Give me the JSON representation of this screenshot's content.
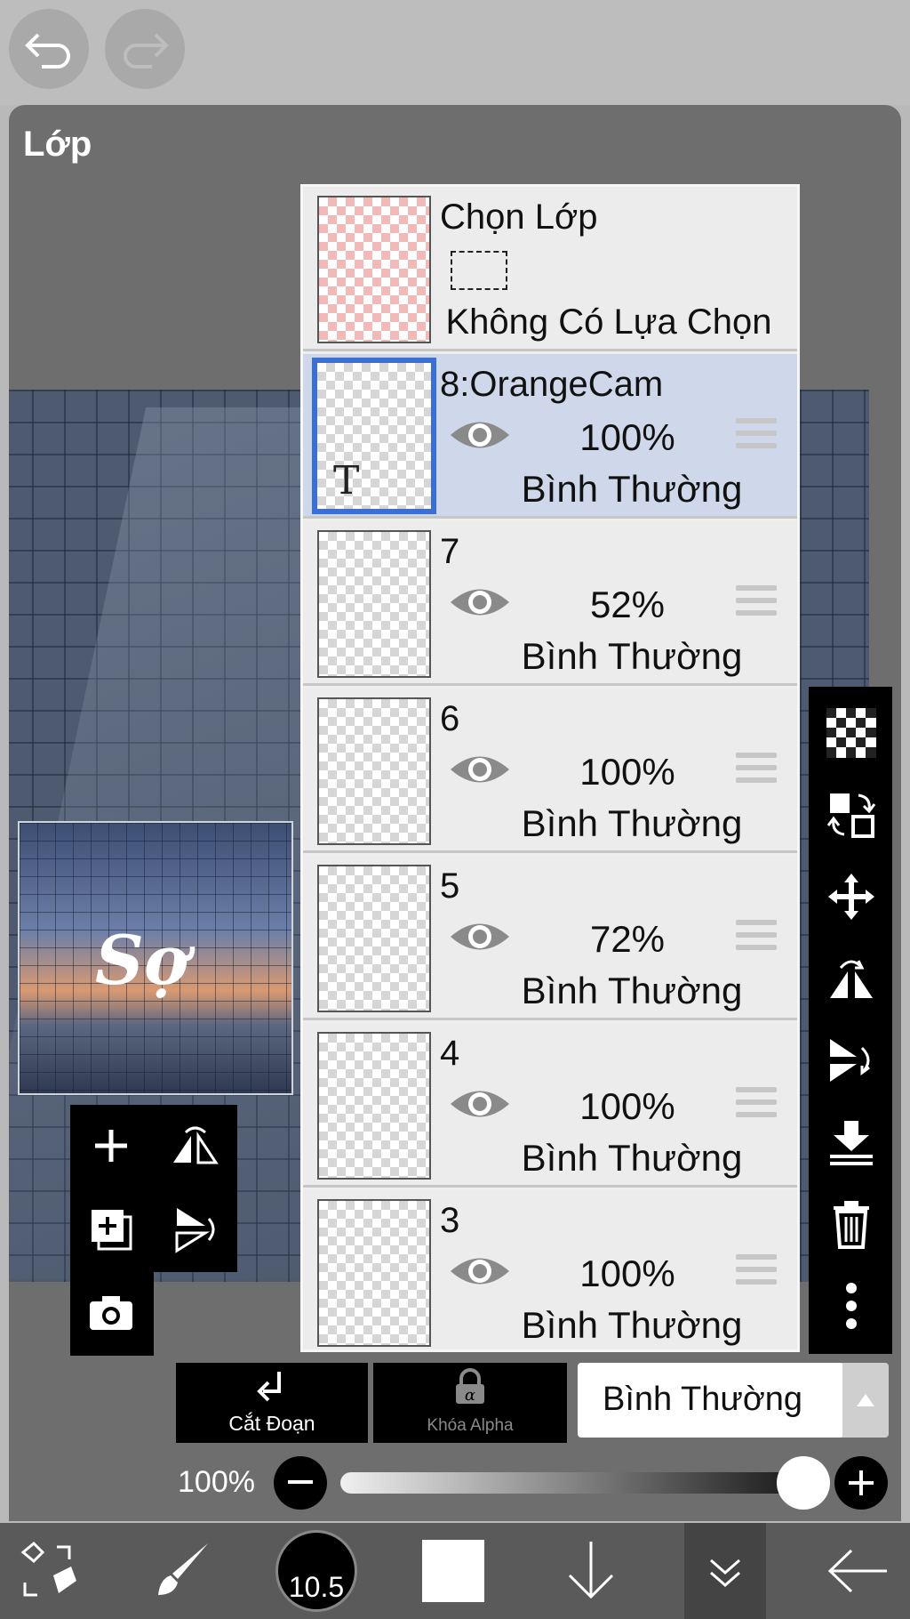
{
  "panel": {
    "title": "Lớp"
  },
  "selection_row": {
    "title": "Chọn Lớp",
    "subtitle": "Không Có Lựa Chọn"
  },
  "layers": [
    {
      "name": "8:OrangeCam",
      "opacity": "100%",
      "blend": "Bình Thường",
      "selected": true,
      "text_layer": true
    },
    {
      "name": "7",
      "opacity": "52%",
      "blend": "Bình Thường"
    },
    {
      "name": "6",
      "opacity": "100%",
      "blend": "Bình Thường"
    },
    {
      "name": "5",
      "opacity": "72%",
      "blend": "Bình Thường"
    },
    {
      "name": "4",
      "opacity": "100%",
      "blend": "Bình Thường"
    },
    {
      "name": "3",
      "opacity": "100%",
      "blend": "Bình Thường"
    }
  ],
  "preview": {
    "text": "Sợ"
  },
  "actions": {
    "clip_label": "Cắt Đoạn",
    "alpha_lock_label": "Khóa Alpha"
  },
  "blend_mode": {
    "value": "Bình Thường"
  },
  "opacity_control": {
    "label": "100%",
    "value": 1.0
  },
  "toolbar": {
    "brush_size": "10.5"
  },
  "colors": {
    "selected_layer": "#cfd8ea",
    "selected_border": "#3a6fd6",
    "panel_bg": "#6e6e6e"
  }
}
